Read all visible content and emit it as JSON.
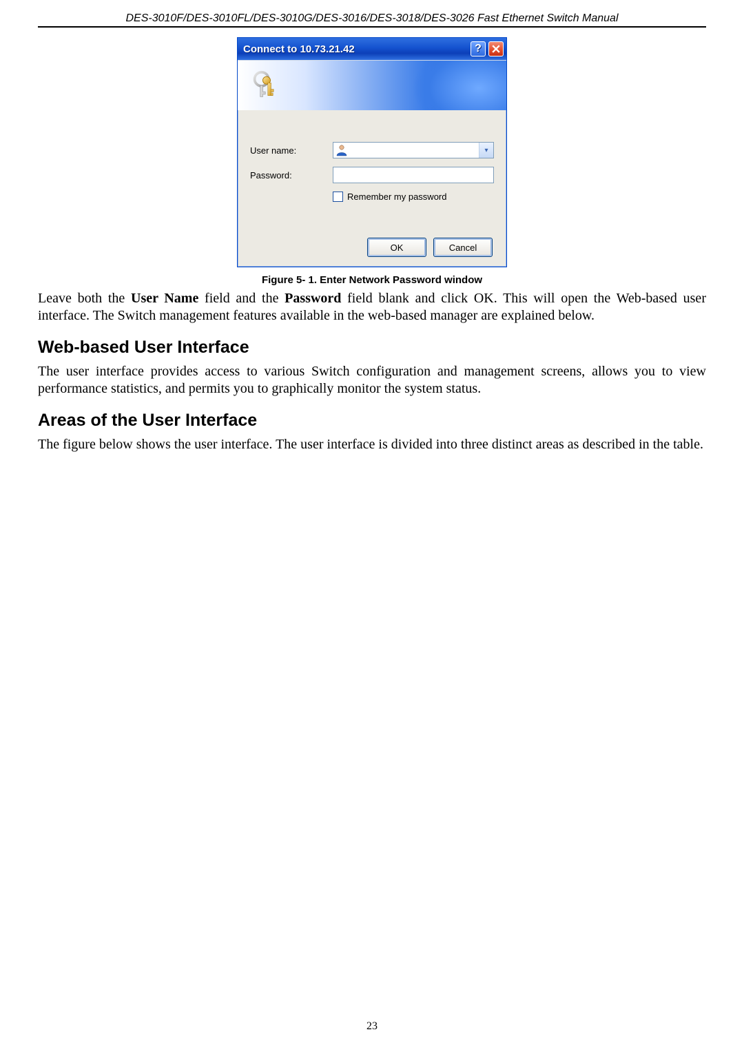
{
  "header": "DES-3010F/DES-3010FL/DES-3010G/DES-3016/DES-3018/DES-3026 Fast Ethernet Switch Manual",
  "dialog": {
    "title": "Connect to 10.73.21.42",
    "labels": {
      "username": "User name:",
      "password": "Password:",
      "remember": "Remember my password"
    },
    "fields": {
      "username": "",
      "password": ""
    },
    "buttons": {
      "ok": "OK",
      "cancel": "Cancel"
    }
  },
  "figure_caption": "Figure 5- 1. Enter Network Password window",
  "paragraphs": {
    "p1_a": "Leave both the ",
    "p1_b": "User Name",
    "p1_c": " field and the ",
    "p1_d": "Password",
    "p1_e": " field blank and click OK. This will open the Web-based user interface. The Switch management features available in the web-based manager are explained below.",
    "p2": "The user interface provides access to various Switch configuration and management screens, allows you to view performance statistics, and permits you to graphically monitor the system status.",
    "p3": "The figure below shows the user interface. The user interface is divided into three distinct areas as described in the table."
  },
  "headings": {
    "h1": "Web-based User Interface",
    "h2": "Areas of the User Interface"
  },
  "page_number": "23"
}
